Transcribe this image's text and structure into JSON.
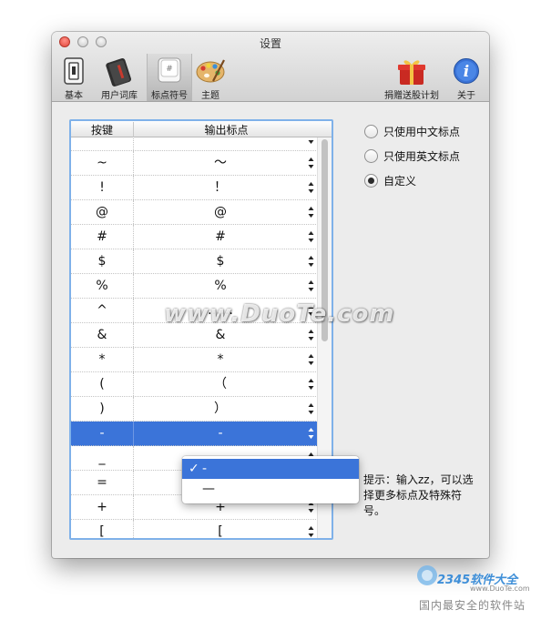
{
  "window": {
    "title": "设置"
  },
  "toolbar": {
    "items": [
      {
        "label": "基本",
        "icon": "switch-icon"
      },
      {
        "label": "用户词库",
        "icon": "notebook-icon"
      },
      {
        "label": "标点符号",
        "icon": "key-icon",
        "selected": true
      },
      {
        "label": "主题",
        "icon": "palette-icon"
      },
      {
        "label": "捐赠送股计划",
        "icon": "gift-icon"
      },
      {
        "label": "关于",
        "icon": "info-icon"
      }
    ]
  },
  "table": {
    "headers": [
      "按键",
      "输出标点"
    ],
    "rows": [
      {
        "key": "`",
        "out": "`"
      },
      {
        "key": "~",
        "out": "～"
      },
      {
        "key": "!",
        "out": "！"
      },
      {
        "key": "@",
        "out": "@"
      },
      {
        "key": "#",
        "out": "#"
      },
      {
        "key": "$",
        "out": "$"
      },
      {
        "key": "%",
        "out": "%"
      },
      {
        "key": "^",
        "out": "……"
      },
      {
        "key": "&",
        "out": "&"
      },
      {
        "key": "*",
        "out": "*"
      },
      {
        "key": "(",
        "out": "（"
      },
      {
        "key": ")",
        "out": "）"
      },
      {
        "key": "-",
        "out": "-",
        "selected": true
      },
      {
        "key": "_",
        "out": ""
      },
      {
        "key": "=",
        "out": ""
      },
      {
        "key": "+",
        "out": "+"
      },
      {
        "key": "[",
        "out": "["
      }
    ]
  },
  "popup": {
    "items": [
      {
        "label": "-",
        "checked": true
      },
      {
        "label": "—",
        "checked": false
      }
    ],
    "check": "✓"
  },
  "options": [
    {
      "label": "只使用中文标点",
      "selected": false
    },
    {
      "label": "只使用英文标点",
      "selected": false
    },
    {
      "label": "自定义",
      "selected": true
    }
  ],
  "hint": "提示：输入zz，可以选择更多标点及特殊符号。",
  "watermark": "www.DuoTe.com",
  "brand": {
    "logo": "2345软件大全",
    "url": "www.DuoTe.com",
    "tagline": "国内最安全的软件站"
  },
  "colors": {
    "selection": "#3b74d9",
    "focus_ring": "#7fb1e9",
    "close": "#e2463a"
  }
}
